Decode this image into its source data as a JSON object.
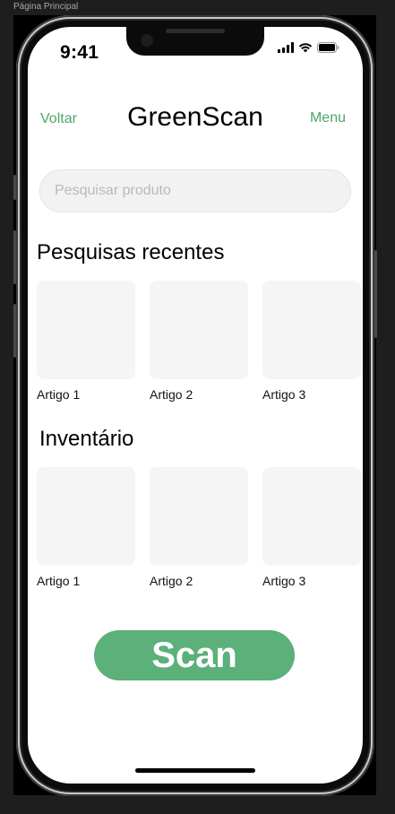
{
  "frame": {
    "label": "Página Principal"
  },
  "status_bar": {
    "time": "9:41",
    "icons": [
      "signal-icon",
      "wifi-icon",
      "battery-icon"
    ]
  },
  "header": {
    "back": "Voltar",
    "title": "GreenScan",
    "menu": "Menu"
  },
  "search": {
    "placeholder": "Pesquisar produto",
    "value": ""
  },
  "recent": {
    "title": "Pesquisas recentes",
    "items": [
      {
        "label": "Artigo 1"
      },
      {
        "label": "Artigo 2"
      },
      {
        "label": "Artigo 3"
      }
    ]
  },
  "inventory": {
    "title": "Inventário",
    "items": [
      {
        "label": "Artigo 1"
      },
      {
        "label": "Artigo 2"
      },
      {
        "label": "Artigo 3"
      }
    ]
  },
  "scan_button": {
    "label": "Scan"
  },
  "colors": {
    "accent": "#4fa56c",
    "button": "#5cb07a",
    "thumb": "#f5f5f5",
    "search_bg": "#f2f2f2"
  }
}
